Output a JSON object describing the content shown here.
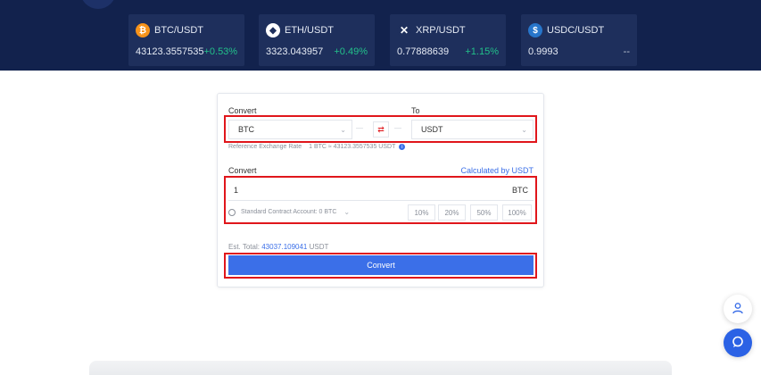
{
  "tickers": [
    {
      "pair": "BTC/USDT",
      "price": "43123.3557535",
      "change": "+0.53%",
      "icon": "bitcoin-icon",
      "color": "#f7931a",
      "glyph": "₿"
    },
    {
      "pair": "ETH/USDT",
      "price": "3323.043957",
      "change": "+0.49%",
      "icon": "ethereum-icon",
      "color": "#ffffff",
      "glyph": "◆"
    },
    {
      "pair": "XRP/USDT",
      "price": "0.77888639",
      "change": "+1.15%",
      "icon": "xrp-icon",
      "color": "#1e2f5c",
      "glyph": "✕"
    },
    {
      "pair": "USDC/USDT",
      "price": "0.9993",
      "change": "--",
      "icon": "usdc-icon",
      "color": "#2775ca",
      "glyph": "$"
    }
  ],
  "convert": {
    "from_label": "Convert",
    "to_label": "To",
    "from_value": "BTC",
    "to_value": "USDT",
    "rate_label": "Reference Exchange Rate",
    "rate_value": "1 BTC ≈ 43123.3557535 USDT",
    "amount_label": "Convert",
    "calc_link": "Calculated by USDT",
    "amount_value": "1",
    "amount_unit": "BTC",
    "account": "Standard Contract Account: 0 BTC",
    "percents": [
      "10%",
      "20%",
      "50%",
      "100%"
    ],
    "est_label": "Est. Total:",
    "est_value": "43037.109041",
    "est_unit": "USDT",
    "button": "Convert"
  },
  "colors": {
    "header_bg": "#12224d",
    "accent": "#3b6fe8",
    "positive": "#22c18a",
    "highlight": "#e0161b"
  }
}
